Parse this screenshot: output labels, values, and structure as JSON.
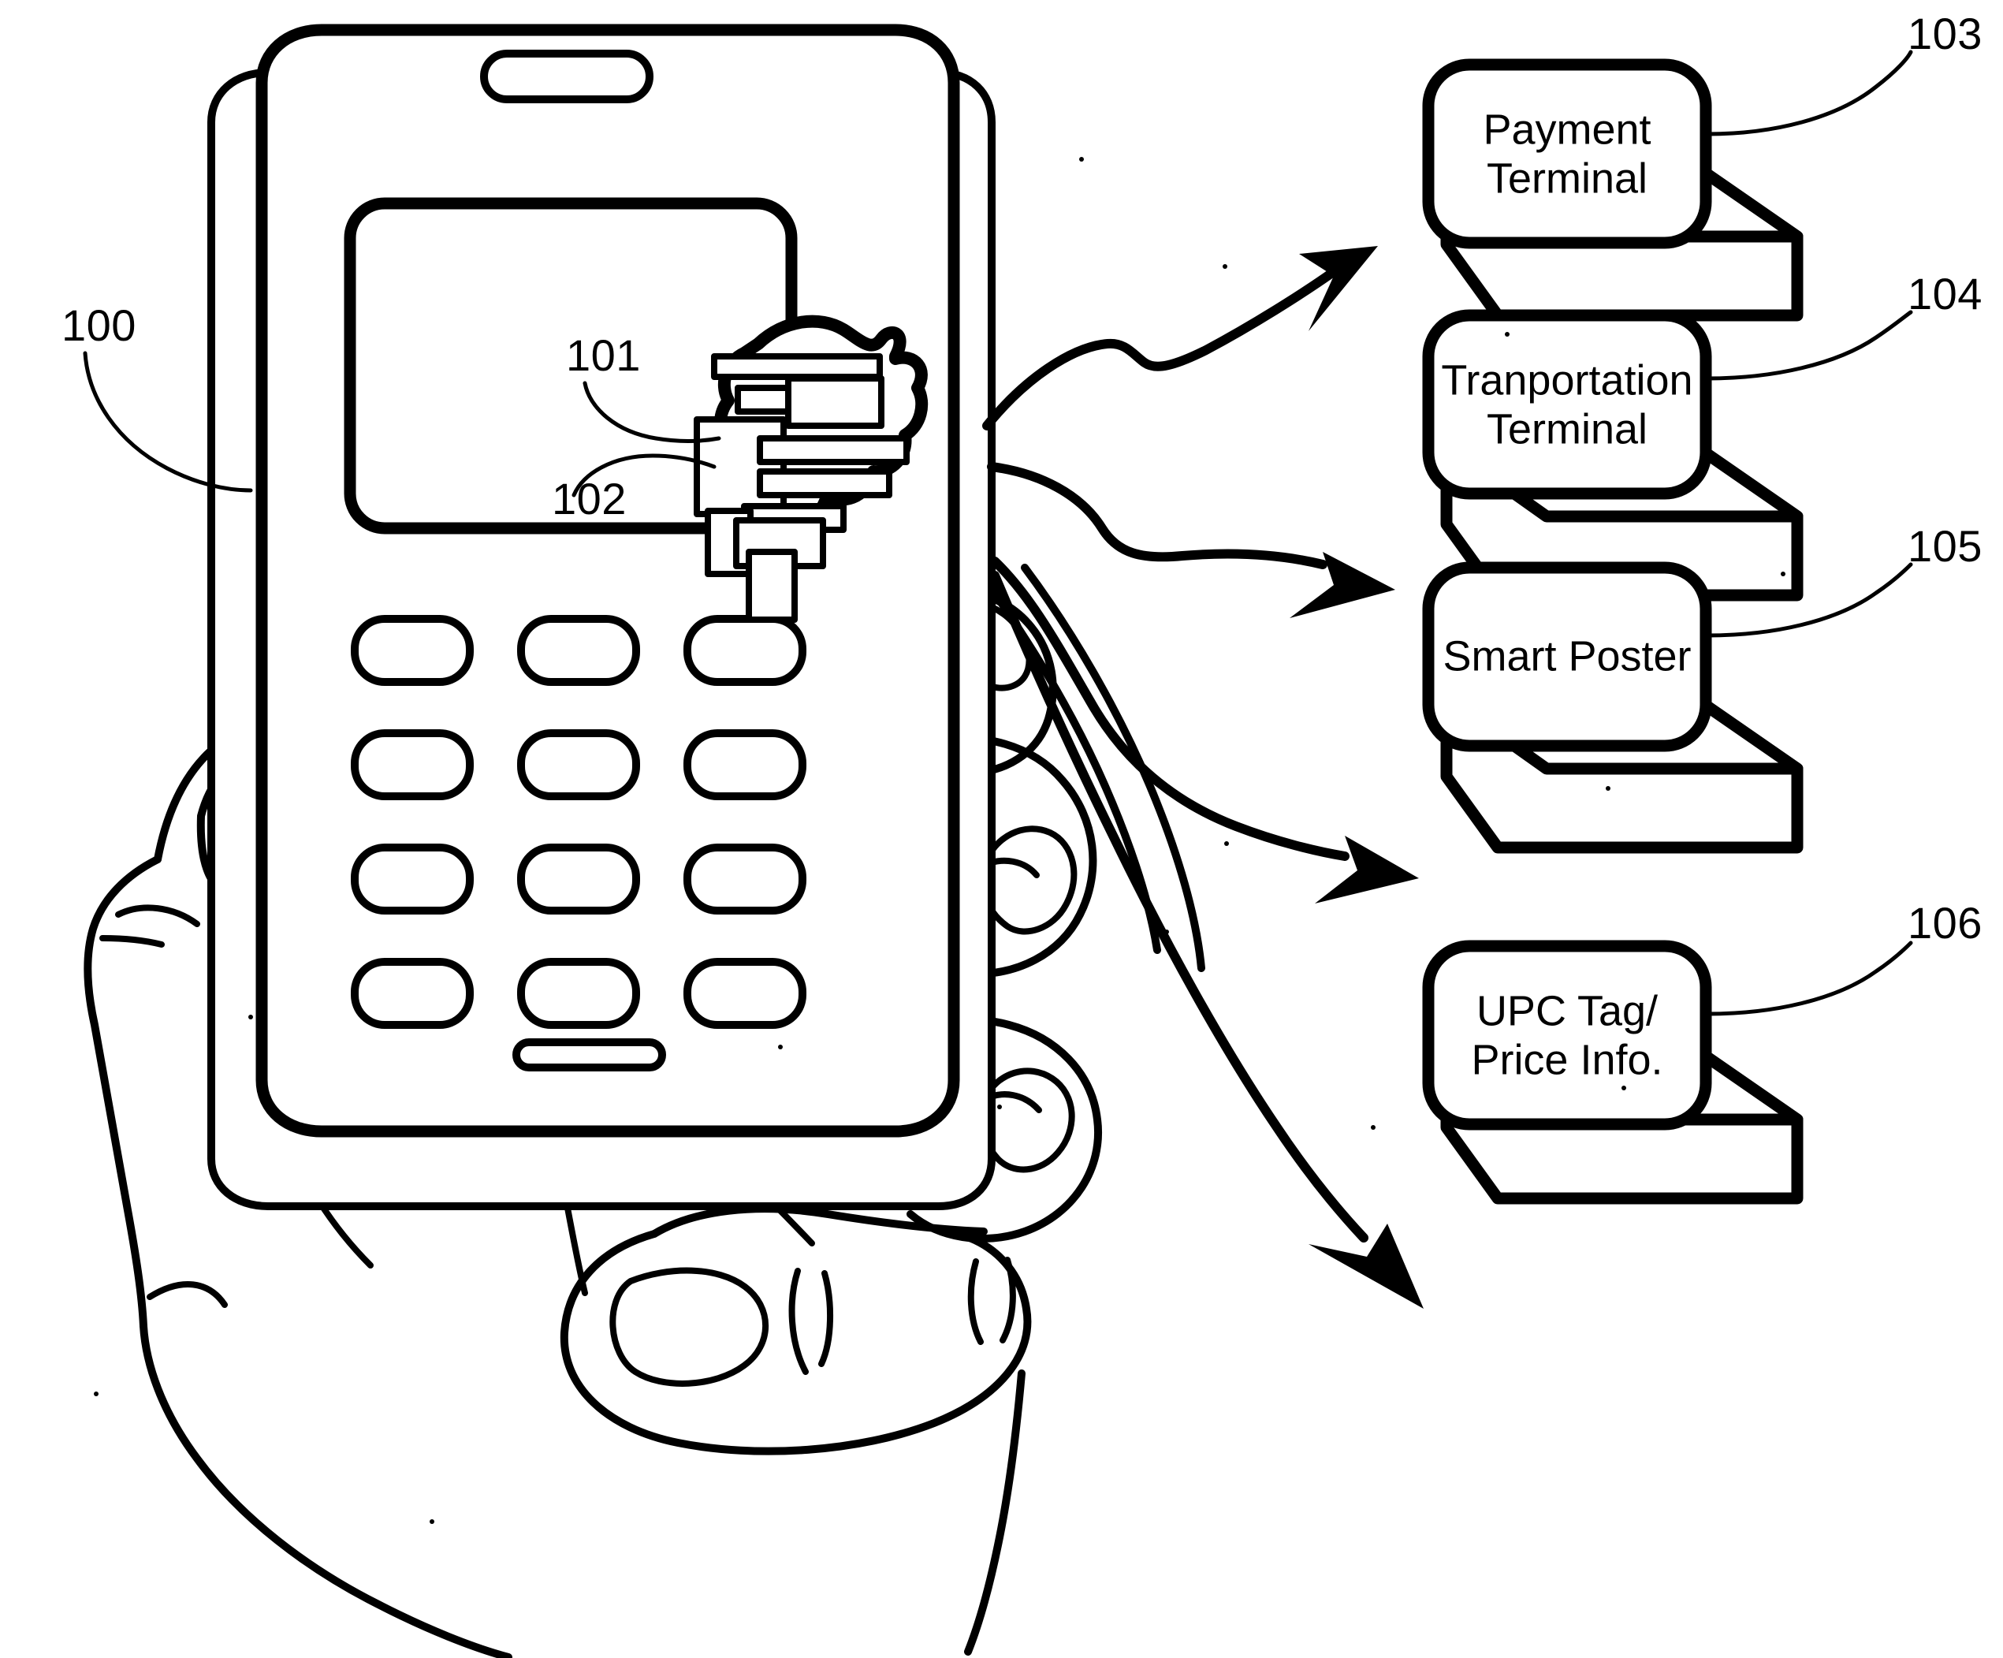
{
  "figure": {
    "kind": "patent-line-drawing",
    "background_color": "#ffffff",
    "ink_color": "#000000",
    "subject": "hand holding mobile phone with NFC chip communicating with four terminal devices"
  },
  "device": {
    "reference_numeral": "100",
    "name": "mobile-phone",
    "screen_label": "",
    "antenna": {
      "reference_numeral": "101",
      "name": "nfc-antenna"
    },
    "chip": {
      "reference_numeral": "102",
      "name": "nfc-chip"
    },
    "keypad": {
      "rows": 4,
      "columns": 3
    }
  },
  "targets": [
    {
      "reference_numeral": "103",
      "name": "payment-terminal",
      "lines": [
        "Payment",
        "Terminal"
      ]
    },
    {
      "reference_numeral": "104",
      "name": "transportation-terminal",
      "lines": [
        "Tranportation",
        "Terminal"
      ]
    },
    {
      "reference_numeral": "105",
      "name": "smart-poster",
      "lines": [
        "Smart Poster"
      ]
    },
    {
      "reference_numeral": "106",
      "name": "upc-tag-price-info",
      "lines": [
        "UPC Tag/",
        "Price Info."
      ]
    }
  ]
}
